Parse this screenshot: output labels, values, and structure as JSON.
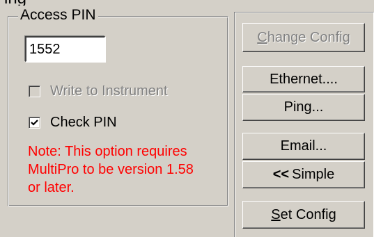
{
  "window": {
    "top_clipped_text": "ing"
  },
  "access_pin": {
    "group_title": "Access PIN",
    "pin_value": "1552",
    "write_to_instrument": {
      "label": "Write to Instrument",
      "checked": false,
      "enabled": false
    },
    "check_pin": {
      "label": "Check PIN",
      "checked": true,
      "enabled": true
    },
    "note_lines": [
      "Note: This option requires",
      "MultiPro to be version 1.58",
      "or later."
    ]
  },
  "buttons": {
    "change_config": {
      "mnemonic": "C",
      "rest": "hange Config",
      "enabled": false
    },
    "ethernet": {
      "label": "Ethernet...."
    },
    "ping": {
      "label": "Ping..."
    },
    "email": {
      "label": "Email..."
    },
    "simple": {
      "glyph": "<<",
      "label": "Simple"
    },
    "set_config": {
      "mnemonic": "S",
      "rest": "et Config"
    }
  },
  "colors": {
    "face": "#d4d0c8",
    "note_text": "#ff0000",
    "disabled_text": "#808080"
  }
}
